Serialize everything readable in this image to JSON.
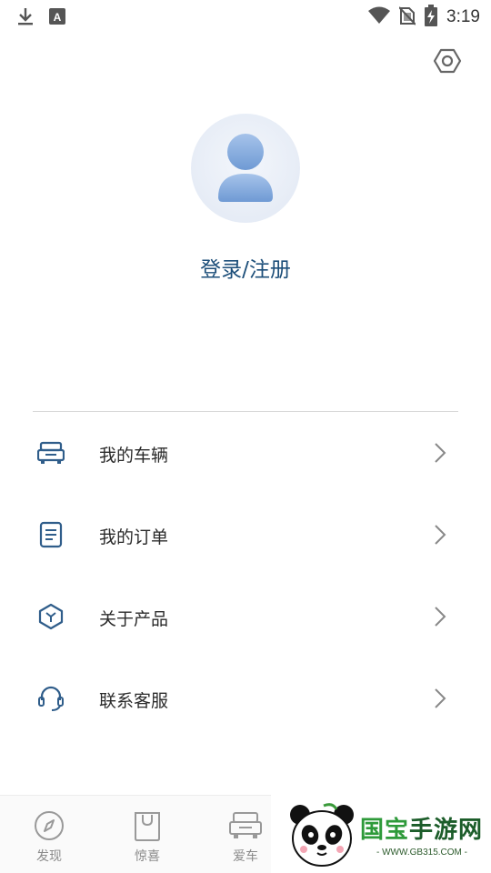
{
  "status_bar": {
    "time": "3:19",
    "left_icons": [
      "download-icon",
      "a-notification-icon"
    ],
    "right_icons": [
      "wifi-icon",
      "no-sim-icon",
      "battery-charging-icon"
    ]
  },
  "header": {
    "settings_icon": "gear-icon"
  },
  "profile": {
    "avatar_icon": "user-avatar-icon",
    "login_label": "登录/注册",
    "accent_color": "#1d4f7a"
  },
  "menu": {
    "items": [
      {
        "label": "我的车辆",
        "icon": "car-icon"
      },
      {
        "label": "我的订单",
        "icon": "order-icon"
      },
      {
        "label": "关于产品",
        "icon": "product-icon"
      },
      {
        "label": "联系客服",
        "icon": "headset-icon"
      }
    ],
    "arrow_icon": "chevron-right-icon"
  },
  "bottom_nav": {
    "items": [
      {
        "label": "发现",
        "icon": "compass-icon"
      },
      {
        "label": "惊喜",
        "icon": "shopping-bag-icon"
      },
      {
        "label": "爱车",
        "icon": "car-icon"
      }
    ]
  },
  "watermark": {
    "brand_part1": "国宝",
    "brand_part2": "手游网",
    "url": "- WWW.GB315.COM -"
  }
}
